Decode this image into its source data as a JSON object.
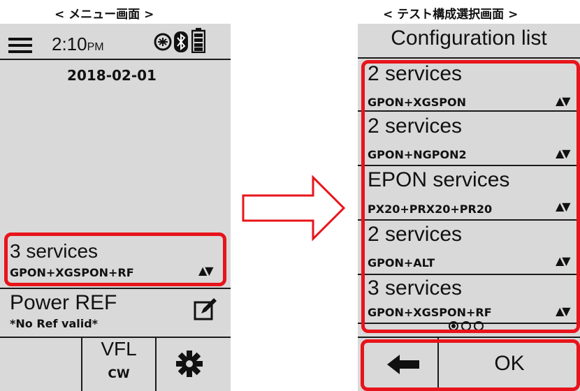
{
  "left_caption": "< メニュー画面 >",
  "right_caption": "< テスト構成選択画面 >",
  "menu": {
    "time": "2:10",
    "time_suffix": "PM",
    "date": "2018-02-01",
    "test_config": {
      "title": "3 services",
      "subtitle": "GPON+XGSPON+RF"
    },
    "power_ref": {
      "title": "Power REF",
      "subtitle": "*No Ref valid*"
    },
    "vfl": {
      "label": "VFL",
      "mode": "CW"
    }
  },
  "config_screen": {
    "title": "Configuration list",
    "items": [
      {
        "title": "2 services",
        "subtitle": "GPON+XGSPON"
      },
      {
        "title": "2 services",
        "subtitle": "GPON+NGPON2"
      },
      {
        "title": "EPON services",
        "subtitle": "PX20+PRX20+PR20"
      },
      {
        "title": "2 services",
        "subtitle": "GPON+ALT"
      },
      {
        "title": "3 services",
        "subtitle": "GPON+XGSPON+RF"
      }
    ],
    "pagination": {
      "current": 1,
      "total": 3
    },
    "ok_label": "OK"
  },
  "colors": {
    "highlight": "#e8141b",
    "screen_bg": "#d9d9d9"
  },
  "icons": [
    "menu-icon",
    "battery-icon",
    "bluetooth-icon",
    "settings-icon",
    "edit-icon",
    "sort-arrows-icon",
    "back-arrow-icon",
    "right-arrow-icon"
  ]
}
